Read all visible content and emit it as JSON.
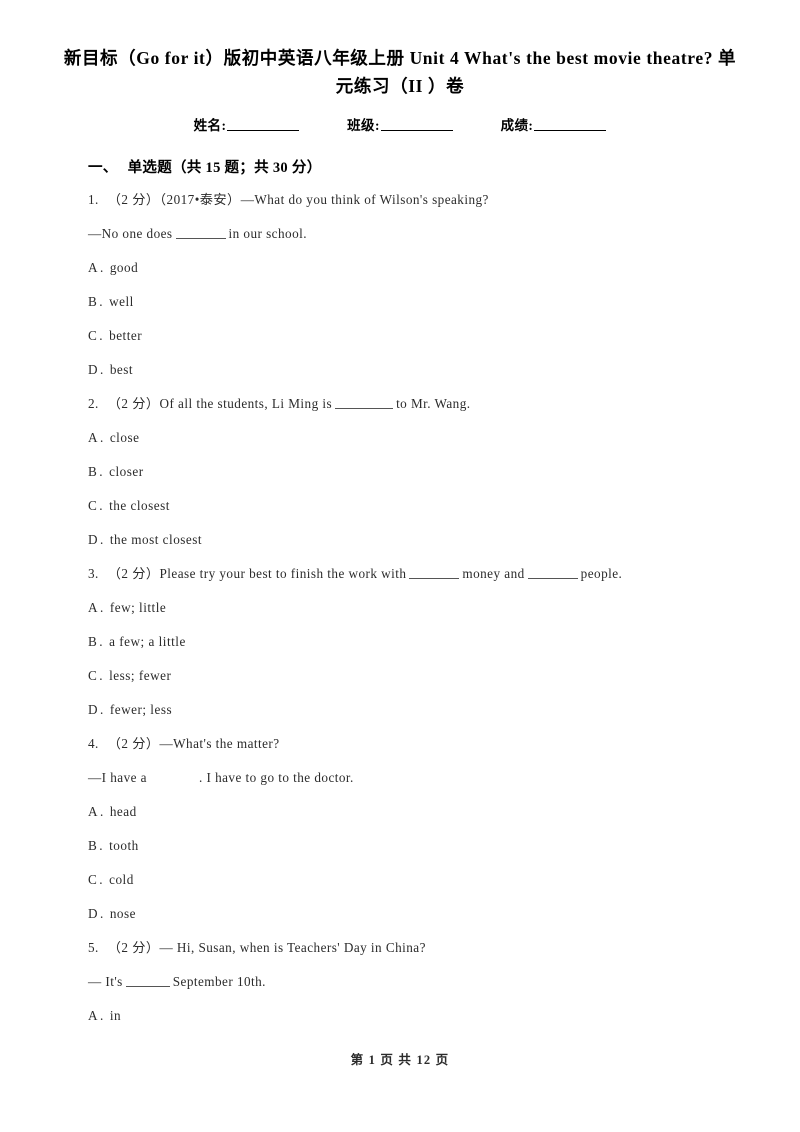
{
  "document": {
    "title_line1": "新目标（Go for it）版初中英语八年级上册 Unit 4 What's the best movie",
    "title_line2": "theatre? 单元练习（II ）卷",
    "info": {
      "name_label": "姓名:",
      "class_label": "班级:",
      "score_label": "成绩:"
    },
    "section": {
      "number": "一、",
      "title": "单选题（共 15 题；共 30 分）"
    },
    "footer": "第 1 页 共 12 页"
  },
  "questions": [
    {
      "number": "1.",
      "points": "（2 分）",
      "source": "（2017•泰安）",
      "stem": "—What do you think of Wilson's speaking?",
      "stem2_pre": "—No one does",
      "stem2_post": "in our school.",
      "options": [
        {
          "letter": "A",
          "dot": ".",
          "text": "good"
        },
        {
          "letter": "B",
          "dot": ".",
          "text": "well"
        },
        {
          "letter": "C",
          "dot": ".",
          "text": "better"
        },
        {
          "letter": "D",
          "dot": ".",
          "text": "best"
        }
      ]
    },
    {
      "number": "2.",
      "points": "（2 分）",
      "stem_pre": "Of all the students, Li Ming is",
      "stem_post": "to Mr. Wang.",
      "options": [
        {
          "letter": "A",
          "dot": ".",
          "text": "close"
        },
        {
          "letter": "B",
          "dot": ".",
          "text": "closer"
        },
        {
          "letter": "C",
          "dot": ".",
          "text": "the closest"
        },
        {
          "letter": "D",
          "dot": ".",
          "text": "the most closest"
        }
      ]
    },
    {
      "number": "3.",
      "points": "（2 分）",
      "stem_pre": "Please try your best to finish the work with",
      "stem_mid": "money and",
      "stem_post": "people.",
      "options": [
        {
          "letter": "A",
          "dot": ".",
          "text": "few; little"
        },
        {
          "letter": "B",
          "dot": ".",
          "text": "a few; a little"
        },
        {
          "letter": "C",
          "dot": ".",
          "text": "less; fewer"
        },
        {
          "letter": "D",
          "dot": ".",
          "text": "fewer; less"
        }
      ]
    },
    {
      "number": "4.",
      "points": "（2 分）",
      "stem": "—What's the matter?",
      "stem2_pre": "—I have a",
      "stem2_post": ". I have to go to the doctor.",
      "options": [
        {
          "letter": "A",
          "dot": ".",
          "text": "head"
        },
        {
          "letter": "B",
          "dot": ".",
          "text": "tooth"
        },
        {
          "letter": "C",
          "dot": ".",
          "text": "cold"
        },
        {
          "letter": "D",
          "dot": ".",
          "text": "nose"
        }
      ]
    },
    {
      "number": "5.",
      "points": "（2 分）",
      "stem": "— Hi, Susan, when is Teachers' Day in China?",
      "stem2_pre": "— It's",
      "stem2_post": "September 10th.",
      "options": [
        {
          "letter": "A",
          "dot": ".",
          "text": "in"
        }
      ]
    }
  ]
}
